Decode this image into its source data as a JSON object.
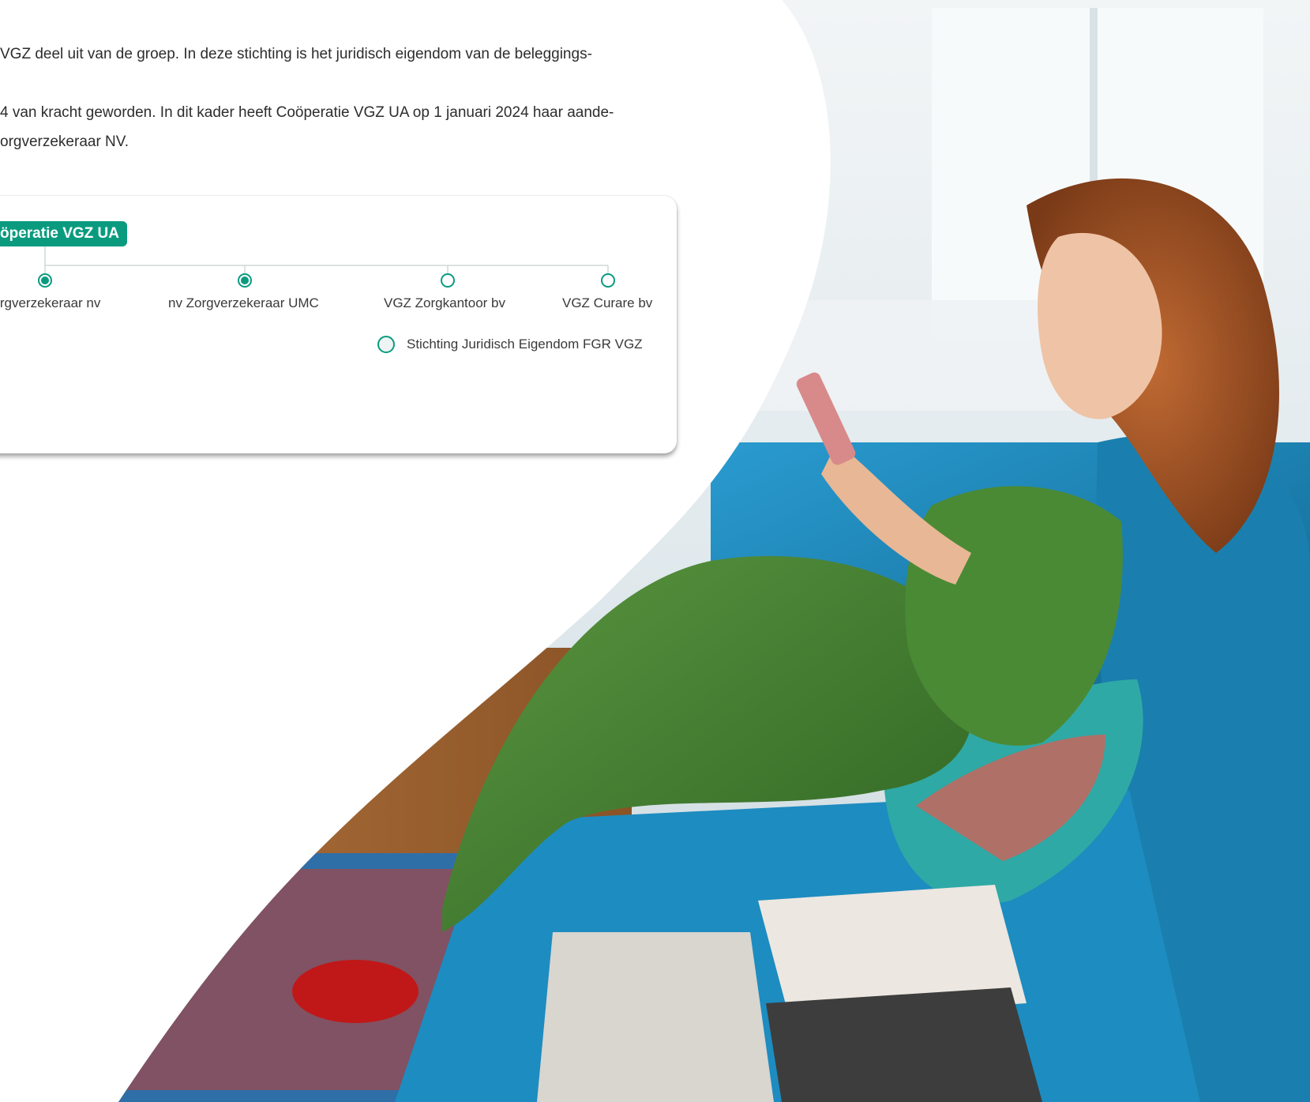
{
  "paragraphs": {
    "p1_line1": "VGZ deel uit van de groep. In deze stichting is het juridisch eigendom van de beleggings-",
    "p2_line1": "4 van kracht geworden. In dit kader heeft Coöperatie VGZ UA op 1 januari 2024 haar aande-",
    "p2_line2": "orgverzekeraar NV."
  },
  "org_chart": {
    "root": "öperatie VGZ UA",
    "children": [
      {
        "label": "Zorgverzekeraar nv",
        "filled": true
      },
      {
        "label": "nv Zorgverzekeraar UMC",
        "filled": true
      },
      {
        "label": "VGZ Zorgkantoor bv",
        "filled": false
      },
      {
        "label": "VGZ Curare bv",
        "filled": false
      }
    ],
    "sub_node": {
      "label": "Stichting Juridisch Eigendom FGR VGZ",
      "filled": false
    }
  },
  "colors": {
    "accent": "#0a9b7f",
    "text": "#2d2d2d",
    "sofa": "#1a7fae",
    "dress": "#3f7a2c",
    "wall": "#e9eef0"
  },
  "photo": {
    "subject": "woman-on-sofa-with-phone"
  }
}
